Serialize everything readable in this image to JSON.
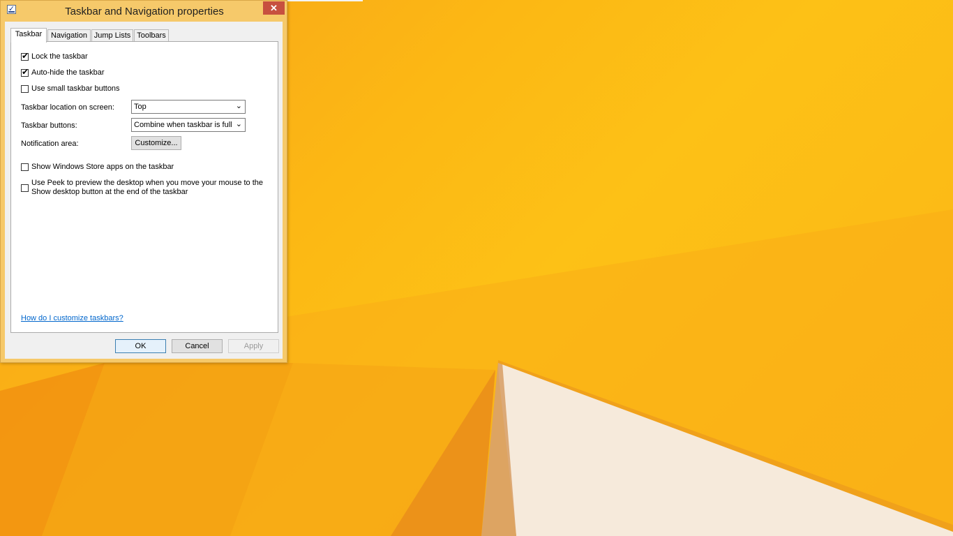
{
  "window": {
    "title": "Taskbar and Navigation properties",
    "icon": "taskbar-properties-icon",
    "close_glyph": "✕"
  },
  "tabs": [
    {
      "label": "Taskbar",
      "active": true
    },
    {
      "label": "Navigation",
      "active": false
    },
    {
      "label": "Jump Lists",
      "active": false
    },
    {
      "label": "Toolbars",
      "active": false
    }
  ],
  "taskbar_tab": {
    "lock_taskbar": {
      "label": "Lock the taskbar",
      "checked": true
    },
    "auto_hide": {
      "label": "Auto-hide the taskbar",
      "checked": true
    },
    "small_buttons": {
      "label": "Use small taskbar buttons",
      "checked": false
    },
    "location": {
      "label": "Taskbar location on screen:",
      "value": "Top"
    },
    "buttons": {
      "label": "Taskbar buttons:",
      "value": "Combine when taskbar is full"
    },
    "notification": {
      "label": "Notification area:",
      "button": "Customize..."
    },
    "store_apps": {
      "label": "Show Windows Store apps on the taskbar",
      "checked": false
    },
    "peek": {
      "label_line1": "Use Peek to preview the desktop when you move your mouse to the",
      "label_line2": "Show desktop button at the end of the taskbar",
      "checked": false
    },
    "help_link": "How do I customize taskbars?"
  },
  "footer": {
    "ok": "OK",
    "cancel": "Cancel",
    "apply": "Apply",
    "apply_enabled": false
  },
  "colors": {
    "wallpaper_primary": "#fcb814",
    "wallpaper_accent": "#f39a12",
    "close_button": "#c7503f",
    "link": "#0066cc"
  }
}
